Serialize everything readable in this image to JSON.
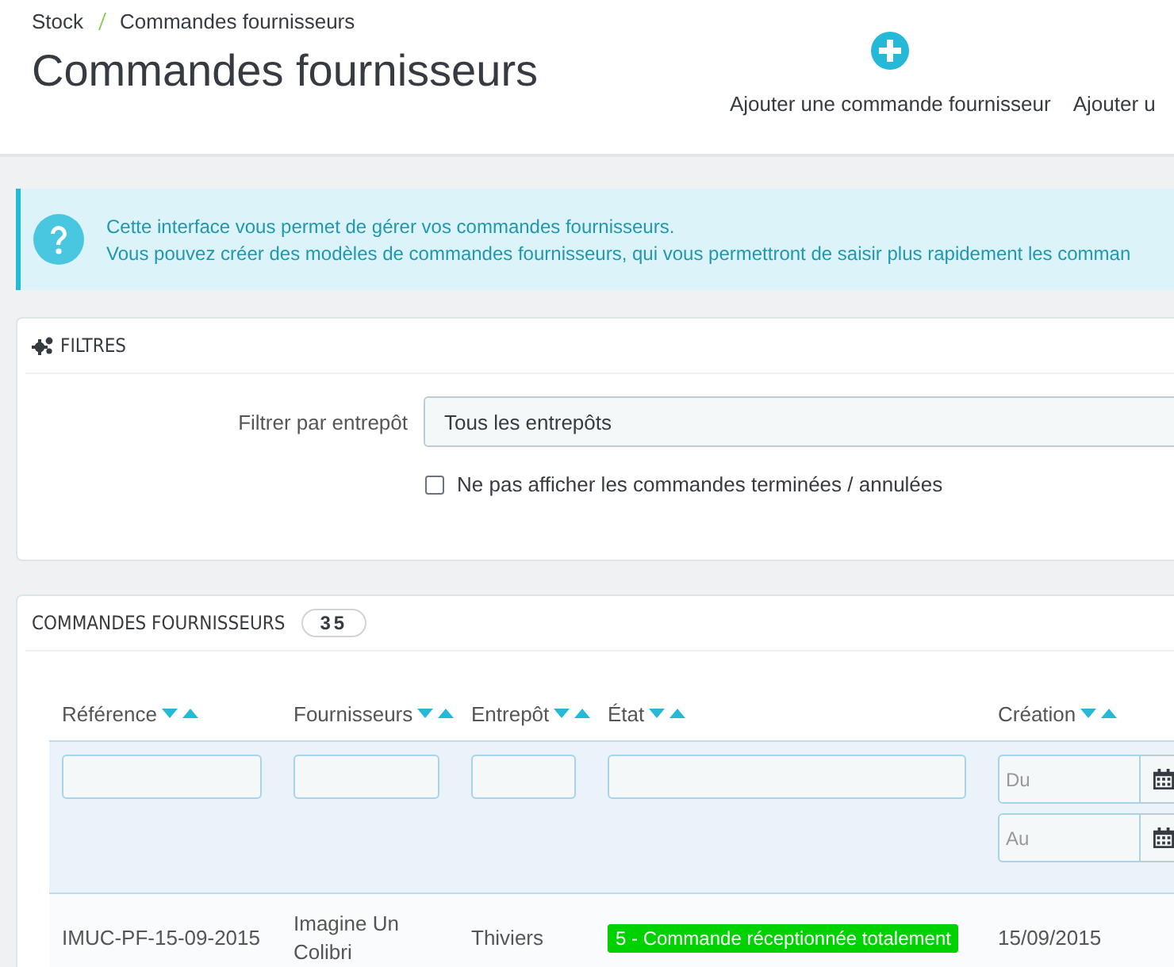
{
  "breadcrumb": [
    "Stock",
    "Commandes fournisseurs"
  ],
  "page_title": "Commandes fournisseurs",
  "toolbar": [
    {
      "label": "Ajouter une commande fournisseur",
      "kind": "add"
    },
    {
      "label": "Ajouter u",
      "kind": "text"
    }
  ],
  "info_alert": {
    "lines": [
      "Cette interface vous permet de gérer vos commandes fournisseurs.",
      "Vous pouvez créer des modèles de commandes fournisseurs, qui vous permettront de saisir plus rapidement les comman"
    ]
  },
  "filters": {
    "title": "FILTRES",
    "warehouse_label": "Filtrer par entrepôt",
    "warehouse_value": "Tous les entrepôts",
    "hide_finished": {
      "label": "Ne pas afficher les commandes terminées / annulées",
      "checked": false
    }
  },
  "orders": {
    "title": "COMMANDES FOURNISSEURS",
    "count": "35",
    "columns": [
      {
        "label": "Référence",
        "kind": "text"
      },
      {
        "label": "Fournisseurs",
        "kind": "text"
      },
      {
        "label": "Entrepôt",
        "kind": "text"
      },
      {
        "label": "État",
        "kind": "text"
      },
      {
        "label": "Création",
        "kind": "date",
        "placeholders": [
          "Du",
          "Au"
        ]
      }
    ],
    "rows": [
      {
        "reference": "IMUC-PF-15-09-2015",
        "supplier": "Imagine Un Colibri",
        "warehouse": "Thiviers",
        "state": "5 - Commande réceptionnée totalement",
        "color": "#00d100",
        "created": "15/09/2015"
      }
    ]
  }
}
